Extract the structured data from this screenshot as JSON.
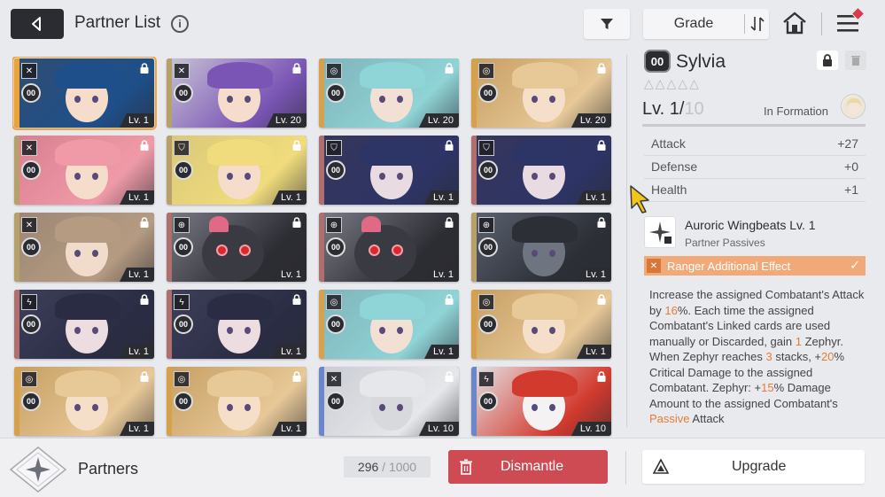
{
  "header": {
    "title": "Partner List",
    "info_icon": "info-icon",
    "back_icon": "back-arrow-icon",
    "filter_icon": "filter-icon",
    "sort_label": "Grade",
    "sort_icon": "sort-order-icon",
    "home_icon": "home-icon",
    "menu_icon": "menu-icon"
  },
  "cards": [
    {
      "level": "Lv. 1",
      "class_icon": "sword-cross-icon",
      "grade": "00",
      "locked": true,
      "selected": true,
      "stripe": "#e8a33a",
      "bg": "#2f4e72",
      "hair": "#1e4f8a",
      "skin": "#f6dccb"
    },
    {
      "level": "Lv. 20",
      "class_icon": "sword-cross-icon",
      "grade": "00",
      "locked": true,
      "stripe": "#b8a06a",
      "bg": "#c8c3d6",
      "hair": "#7a55b5",
      "skin": "#f6dccb"
    },
    {
      "level": "Lv. 20",
      "class_icon": "target-icon",
      "grade": "00",
      "locked": true,
      "stripe": "#d6a14a",
      "bg": "#7fb3ba",
      "hair": "#8fd4d6",
      "skin": "#f3e0d4"
    },
    {
      "level": "Lv. 20",
      "class_icon": "target-icon",
      "grade": "00",
      "locked": true,
      "stripe": "#d6a14a",
      "bg": "#c69e62",
      "hair": "#e7c897",
      "skin": "#f5dfc9"
    },
    {
      "level": "Lv. 1",
      "class_icon": "sword-cross-icon",
      "grade": "00",
      "locked": true,
      "stripe": "#b8a06a",
      "bg": "#d97f8f",
      "hair": "#f09aa8",
      "skin": "#f6dccb"
    },
    {
      "level": "Lv. 1",
      "class_icon": "shield-icon",
      "grade": "00",
      "locked": true,
      "stripe": "#b8a06a",
      "bg": "#d9c87a",
      "hair": "#f0dc7c",
      "skin": "#f6dccb"
    },
    {
      "level": "Lv. 1",
      "class_icon": "shield-icon",
      "grade": "00",
      "locked": true,
      "stripe": "#b06f6f",
      "bg": "#36365a",
      "hair": "#2d3466",
      "skin": "#e8dbe1"
    },
    {
      "level": "Lv. 1",
      "class_icon": "shield-icon",
      "grade": "00",
      "locked": true,
      "stripe": "#b06f6f",
      "bg": "#36365a",
      "hair": "#2d3466",
      "skin": "#e8dbe1"
    },
    {
      "level": "Lv. 1",
      "class_icon": "sword-cross-icon",
      "grade": "00",
      "locked": true,
      "stripe": "#b8a06a",
      "bg": "#9c8774",
      "hair": "#b59b82",
      "skin": "#f1dccb"
    },
    {
      "level": "Lv. 1",
      "class_icon": "crosshair-icon",
      "grade": "00",
      "locked": true,
      "stripe": "#b06f6f",
      "bg": "#7b7b86",
      "hair": "#2c2c33",
      "skin": "#3a3a42",
      "creature": true
    },
    {
      "level": "Lv. 1",
      "class_icon": "crosshair-icon",
      "grade": "00",
      "locked": true,
      "stripe": "#b06f6f",
      "bg": "#7b7b86",
      "hair": "#2c2c33",
      "skin": "#3a3a42",
      "creature": true
    },
    {
      "level": "Lv. 1",
      "class_icon": "crosshair-icon",
      "grade": "00",
      "locked": true,
      "stripe": "#b8a06a",
      "bg": "#5b6270",
      "hair": "#2c2f36",
      "skin": "#6e7580"
    },
    {
      "level": "Lv. 1",
      "class_icon": "lightning-icon",
      "grade": "00",
      "locked": true,
      "stripe": "#b06f6f",
      "bg": "#3e3f5a",
      "hair": "#2a2c44",
      "skin": "#eedde0"
    },
    {
      "level": "Lv. 1",
      "class_icon": "lightning-icon",
      "grade": "00",
      "locked": true,
      "stripe": "#b06f6f",
      "bg": "#3e3f5a",
      "hair": "#2a2c44",
      "skin": "#eedde0"
    },
    {
      "level": "Lv. 1",
      "class_icon": "target-icon",
      "grade": "00",
      "locked": true,
      "stripe": "#d6a14a",
      "bg": "#7fb3ba",
      "hair": "#8fd4d6",
      "skin": "#f3e0d4"
    },
    {
      "level": "Lv. 1",
      "class_icon": "target-icon",
      "grade": "00",
      "locked": true,
      "stripe": "#d6a14a",
      "bg": "#c69e62",
      "hair": "#e7c897",
      "skin": "#f5dfc9"
    },
    {
      "level": "Lv. 1",
      "class_icon": "target-icon",
      "grade": "00",
      "locked": true,
      "stripe": "#d6a14a",
      "bg": "#c69e62",
      "hair": "#e7c897",
      "skin": "#f5dfc9"
    },
    {
      "level": "Lv. 1",
      "class_icon": "target-icon",
      "grade": "00",
      "locked": true,
      "stripe": "#d6a14a",
      "bg": "#c69e62",
      "hair": "#e7c897",
      "skin": "#f5dfc9"
    },
    {
      "level": "Lv. 10",
      "class_icon": "sword-cross-icon",
      "grade": "00",
      "locked": true,
      "stripe": "#6a88c9",
      "bg": "#c9ccd4",
      "hair": "#e6e7ea",
      "skin": "#d8d9dd"
    },
    {
      "level": "Lv. 10",
      "class_icon": "lightning-icon",
      "grade": "00",
      "locked": true,
      "stripe": "#6a88c9",
      "bg": "#e5e3e6",
      "hair": "#d23a2e",
      "skin": "#f4f2f3"
    }
  ],
  "detail": {
    "grade": "00",
    "name": "Sylvia",
    "lock_icon": "lock-icon",
    "trash_icon": "trash-icon",
    "stars": "△△△△△",
    "level_current": "Lv. 1/",
    "level_max": "10",
    "formation_label": "In Formation",
    "stats": [
      {
        "label": "Attack",
        "value": "+27"
      },
      {
        "label": "Defense",
        "value": "+0"
      },
      {
        "label": "Health",
        "value": "+1"
      }
    ],
    "passive_name": "Auroric Wingbeats Lv. 1",
    "passive_type": "Partner Passives",
    "effect_label": "Ranger Additional Effect",
    "description": [
      {
        "t": "Increase the assigned Combatant's Attack by "
      },
      {
        "t": "16",
        "hl": true
      },
      {
        "t": "%. Each time the assigned Combatant's Linked cards are used manually or Discarded, gain "
      },
      {
        "t": "1",
        "hl": true
      },
      {
        "t": " Zephyr. When Zephyr reaches "
      },
      {
        "t": "3",
        "hl": true
      },
      {
        "t": " stacks, +"
      },
      {
        "t": "20",
        "hl": true
      },
      {
        "t": "% Critical Damage to the assigned Combatant. Zephyr: +"
      },
      {
        "t": "15",
        "hl": true
      },
      {
        "t": "% Damage Amount to the assigned Combatant's "
      },
      {
        "t": "Passive",
        "hl": true
      },
      {
        "t": " Attack"
      }
    ]
  },
  "footer": {
    "partners_label": "Partners",
    "count_current": "296",
    "count_sep": " / ",
    "count_max": "1000",
    "dismantle_label": "Dismantle",
    "upgrade_label": "Upgrade"
  },
  "colors": {
    "accent_orange": "#f0a43a",
    "dismantle_red": "#cf4b54",
    "highlight": "#e57c35"
  }
}
